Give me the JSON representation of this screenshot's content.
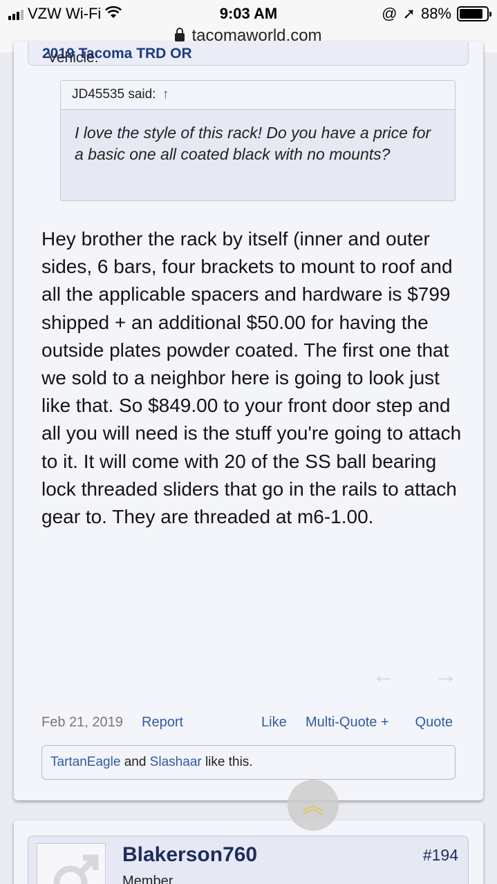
{
  "status": {
    "carrier": "VZW Wi-Fi",
    "time": "9:03 AM",
    "battery": "88%"
  },
  "browser": {
    "url": "tacomaworld.com"
  },
  "post": {
    "vehicle_label": "Vehicle:",
    "vehicle_value": "2019 Tacoma TRD OR",
    "quote_author": "JD45535 said:",
    "quote_arrow": "↑",
    "quote_text": "I love the style of this rack! Do you have a price for a basic one all coated black with no mounts?",
    "message": "Hey brother the rack by itself (inner and outer sides, 6 bars, four brackets to mount to roof and all the applicable spacers and hardware is $799 shipped + an additional $50.00 for having the outside plates powder coated. The first one that we sold to a neighbor here is going to look just like that. So $849.00 to your front door step and all you will need is the stuff you're going to attach to it. It will come with 20 of the SS ball bearing lock threaded sliders that go in the rails to attach gear to. They are threaded at m6-1.00.",
    "date": "Feb 21, 2019",
    "report": "Report",
    "like": "Like",
    "multi_quote": "Multi-Quote +",
    "quote": "Quote",
    "liked_by_1": "TartanEagle",
    "liked_and": "and",
    "liked_by_2": "Slashaar",
    "liked_suffix": "like this."
  },
  "next_post": {
    "username": "Blakerson760",
    "user_title": "Member",
    "post_number": "#194"
  }
}
